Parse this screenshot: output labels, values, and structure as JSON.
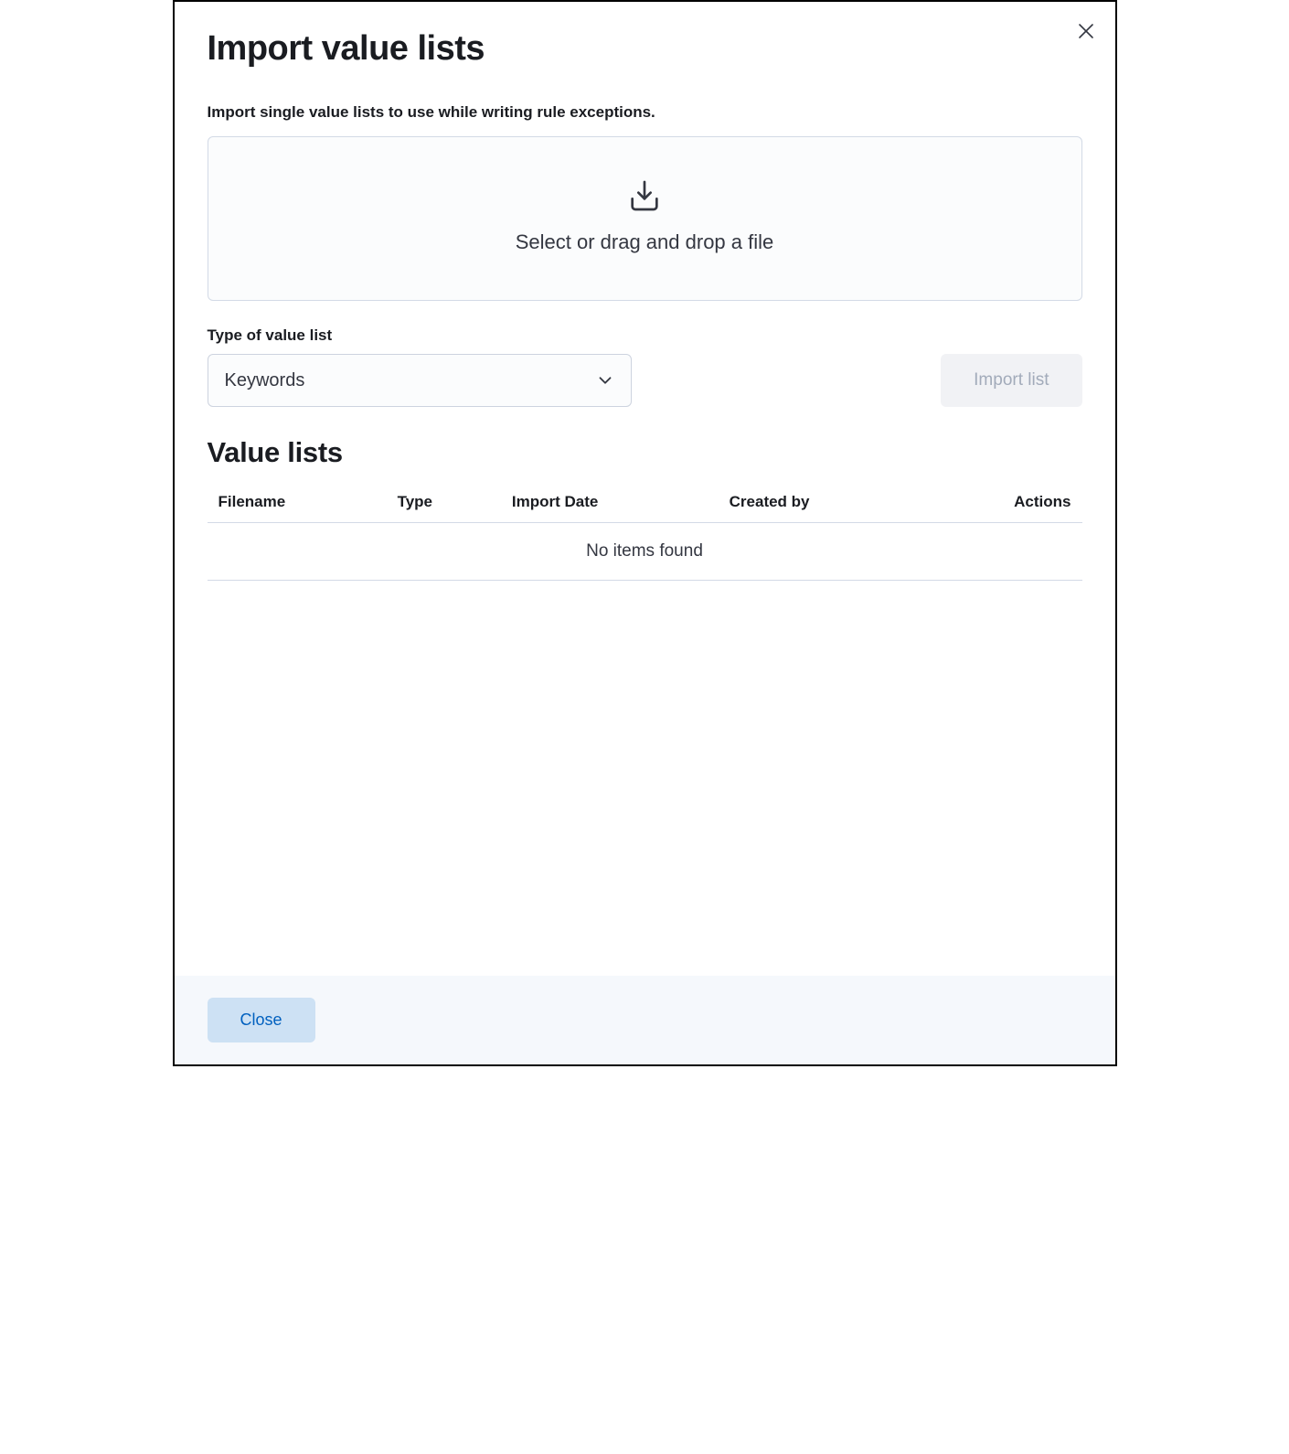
{
  "modal": {
    "title": "Import value lists",
    "subtitle": "Import single value lists to use while writing rule exceptions.",
    "dropzone_text": "Select or drag and drop a file",
    "type_label": "Type of value list",
    "type_selected": "Keywords",
    "import_button": "Import list",
    "section_title": "Value lists",
    "columns": {
      "filename": "Filename",
      "type": "Type",
      "import_date": "Import Date",
      "created_by": "Created by",
      "actions": "Actions"
    },
    "empty_message": "No items found",
    "close_button": "Close"
  }
}
